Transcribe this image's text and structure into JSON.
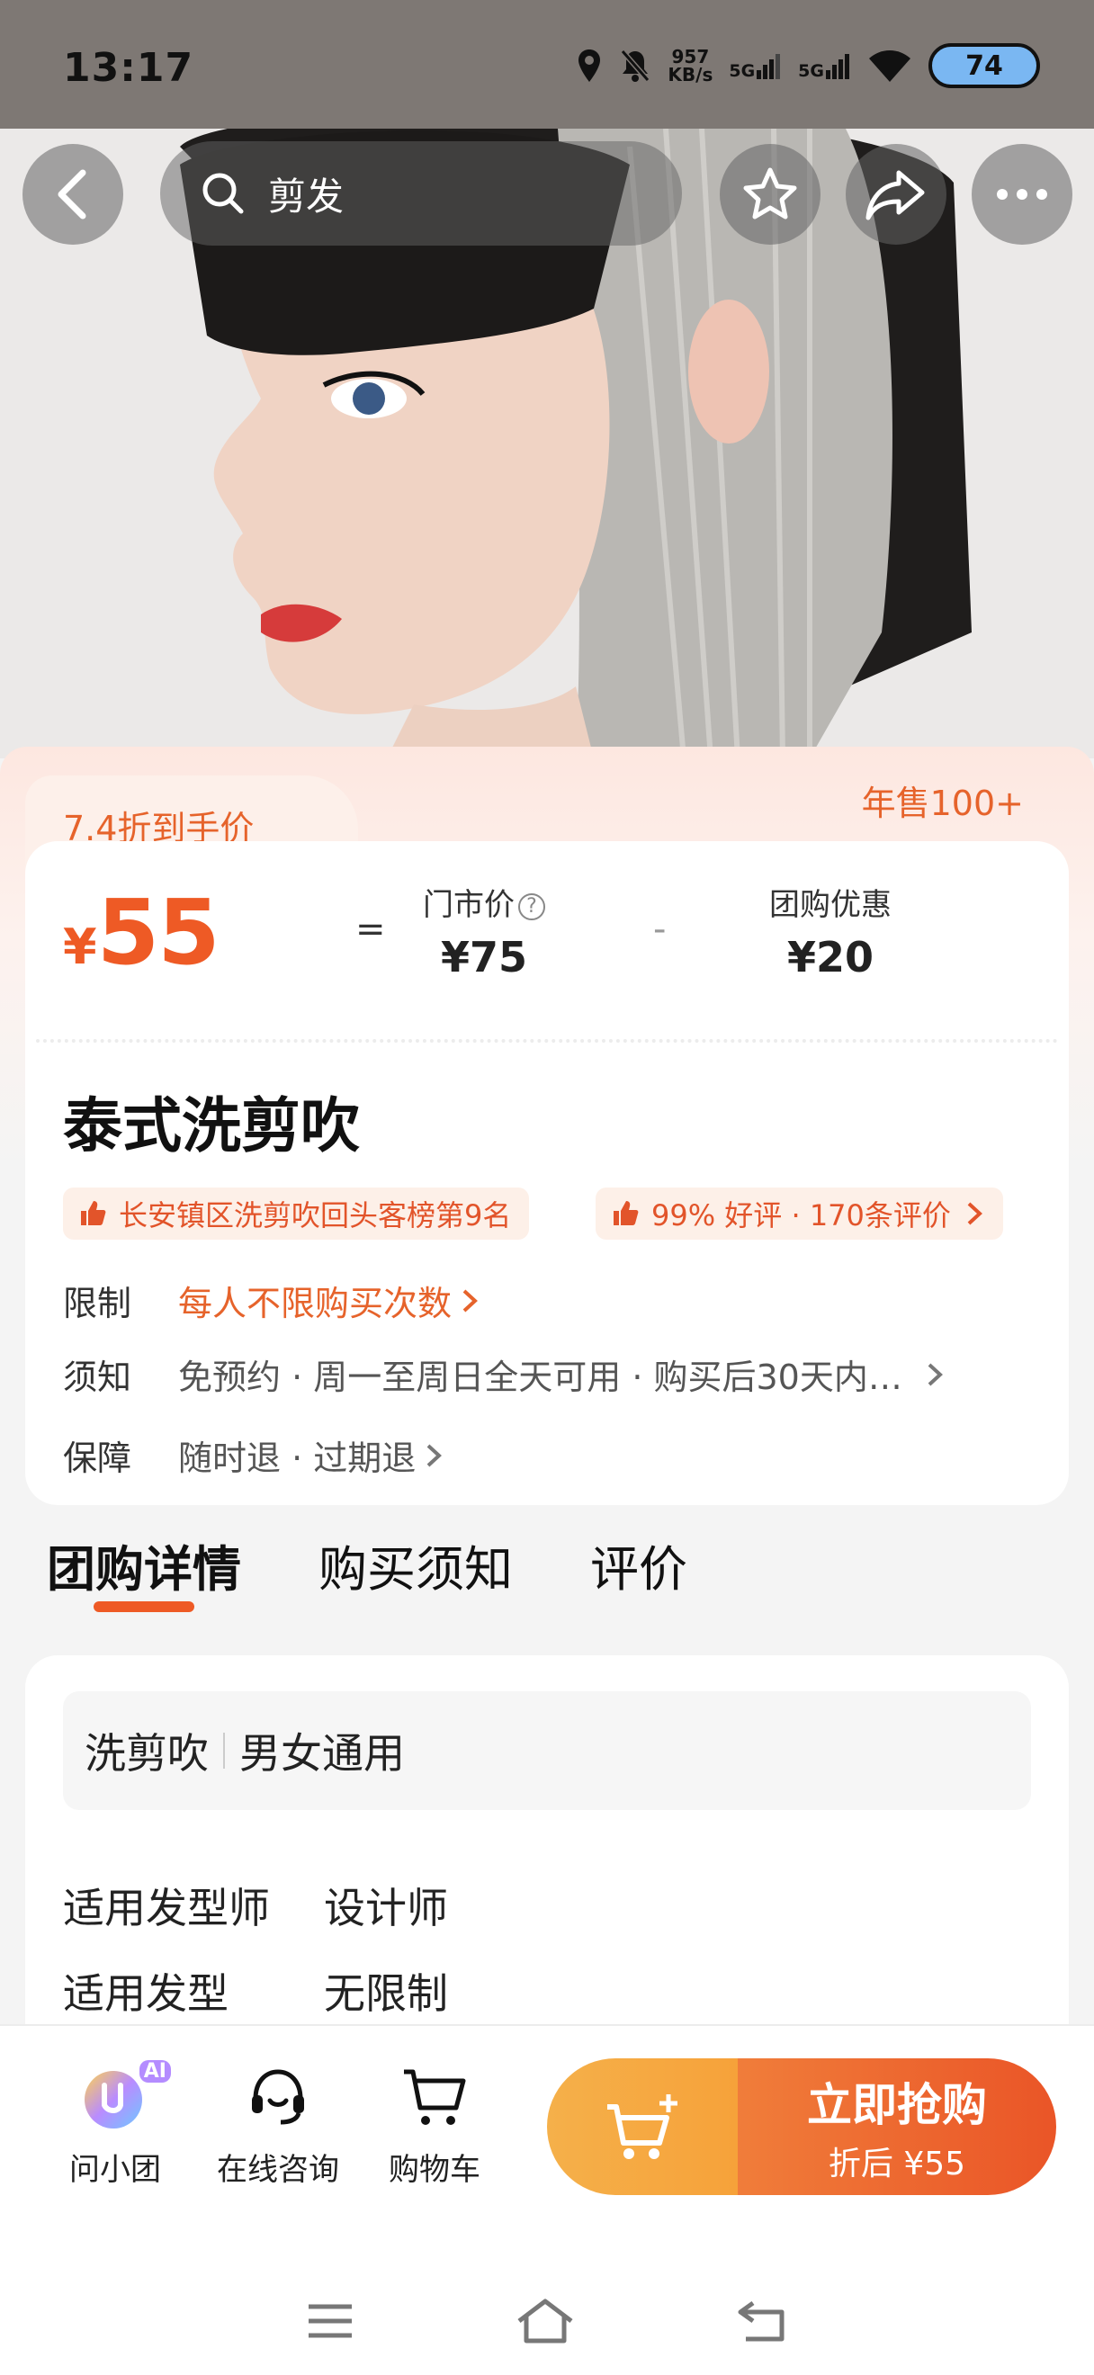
{
  "status_bar": {
    "time": "13:17",
    "net_speed_value": "957",
    "net_speed_unit": "KB/s",
    "sim1": "5G",
    "sim2": "5G",
    "battery": "74"
  },
  "header": {
    "search_query": "剪发"
  },
  "price": {
    "discount_label": "7.4折到手价",
    "sales": "年售100+",
    "currency": "¥",
    "final_price": "55",
    "equals": "=",
    "minus": "-",
    "market_label": "门市价",
    "market_value": "¥75",
    "group_label": "团购优惠",
    "group_value": "¥20"
  },
  "product": {
    "title": "泰式洗剪吹",
    "rank_badge": "长安镇区洗剪吹回头客榜第9名",
    "review_badge": "99% 好评 · 170条评价",
    "rows": [
      {
        "key": "限制",
        "value": "每人不限购买次数"
      },
      {
        "key": "须知",
        "value": "免预约 · 周一至周日全天可用 · 购买后30天内…"
      },
      {
        "key": "保障",
        "value": "随时退 · 过期退"
      }
    ]
  },
  "tabs": [
    "团购详情",
    "购买须知",
    "评价"
  ],
  "detail": {
    "service": "洗剪吹",
    "gender": "男女通用",
    "rows": [
      {
        "key": "适用发型师",
        "value": "设计师"
      },
      {
        "key": "适用发型",
        "value": "无限制"
      }
    ]
  },
  "bottom": {
    "assistant": "问小团",
    "assistant_badge": "AI",
    "consult": "在线咨询",
    "cart": "购物车",
    "buy_label": "立即抢购",
    "buy_sub": "折后 ¥55"
  },
  "colors": {
    "accent": "#ee5a25",
    "badge_bg": "#fdf0e8"
  }
}
